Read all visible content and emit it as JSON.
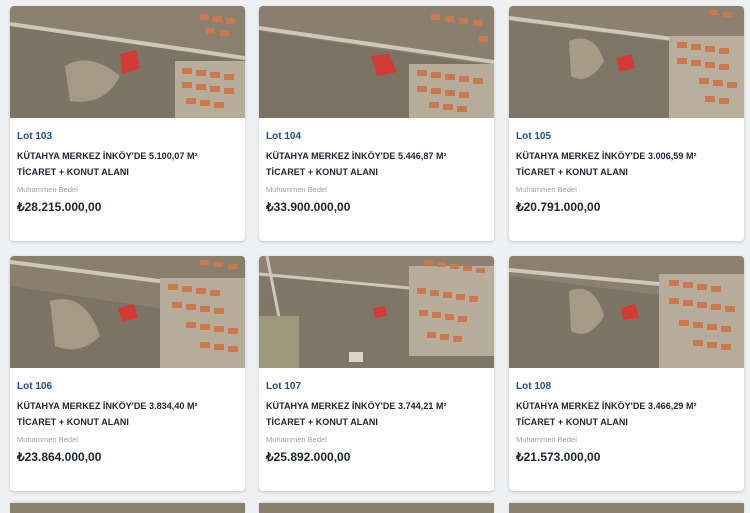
{
  "listings": [
    {
      "lot": "Lot 103",
      "title": "KÜTAHYA MERKEZ İNKÖY'DE 5.100,07 M² TİCARET + KONUT ALANI",
      "price_label": "Muhammen Bedel",
      "price": "₺28.215.000,00"
    },
    {
      "lot": "Lot 104",
      "title": "KÜTAHYA MERKEZ İNKÖY'DE 5.446,87 M² TİCARET + KONUT ALANI",
      "price_label": "Muhammen Bedel",
      "price": "₺33.900.000,00"
    },
    {
      "lot": "Lot 105",
      "title": "KÜTAHYA MERKEZ İNKÖY'DE 3.006,59 M² TİCARET + KONUT ALANI",
      "price_label": "Muhammen Bedel",
      "price": "₺20.791.000,00"
    },
    {
      "lot": "Lot 106",
      "title": "KÜTAHYA MERKEZ İNKÖY'DE 3.834,40 M² TİCARET + KONUT ALANI",
      "price_label": "Muhammen Bedel",
      "price": "₺23.864.000,00"
    },
    {
      "lot": "Lot 107",
      "title": "KÜTAHYA MERKEZ İNKÖY'DE 3.744,21 M² TİCARET + KONUT ALANI",
      "price_label": "Muhammen Bedel",
      "price": "₺25.892.000,00"
    },
    {
      "lot": "Lot 108",
      "title": "KÜTAHYA MERKEZ İNKÖY'DE 3.466,29 M² TİCARET + KONUT ALANI",
      "price_label": "Muhammen Bedel",
      "price": "₺21.573.000,00"
    }
  ],
  "colors": {
    "lot_text": "#1f4f8a",
    "parcel_highlight": "#e0302f",
    "terrain": "#8a7f6f",
    "rooftops": "#c9794f"
  }
}
